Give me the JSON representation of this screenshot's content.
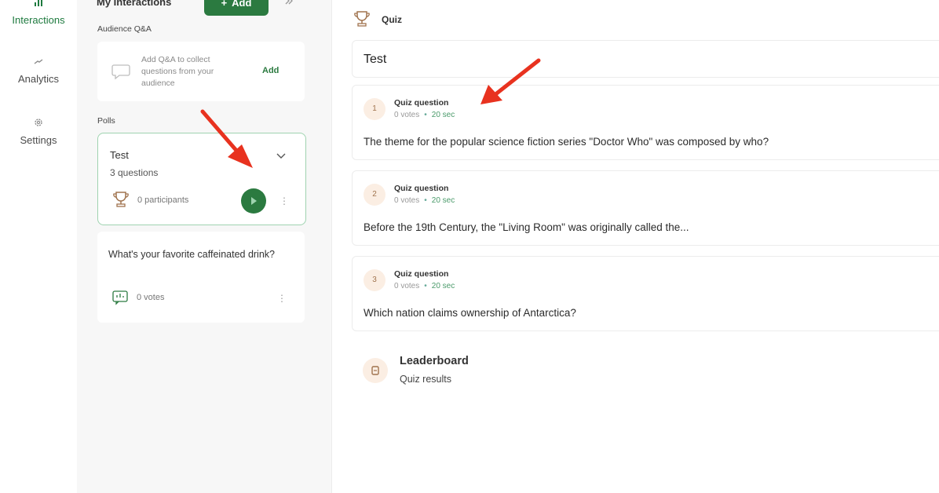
{
  "nav": {
    "items": [
      {
        "label": "Interactions",
        "icon": "bar-chart-icon",
        "active": true
      },
      {
        "label": "Analytics",
        "icon": "trend-icon",
        "active": false
      },
      {
        "label": "Settings",
        "icon": "gear-icon",
        "active": false
      }
    ]
  },
  "panel": {
    "title": "My Interactions",
    "add_button": "Add",
    "audience_qa_label": "Audience Q&A",
    "qa_card": {
      "text": "Add Q&A to collect questions from your audience",
      "action": "Add"
    },
    "polls_label": "Polls",
    "quiz_card": {
      "title": "Test",
      "subtitle": "3 questions",
      "participants": "0 participants"
    },
    "poll_card": {
      "title": "What's your favorite caffeinated drink?",
      "votes": "0 votes"
    }
  },
  "main": {
    "header": "Quiz",
    "quiz_title": "Test",
    "questions": [
      {
        "num": "1",
        "type": "Quiz question",
        "votes": "0 votes",
        "time": "20 sec",
        "text": "The theme for the popular science fiction series \"Doctor Who\" was composed by who?"
      },
      {
        "num": "2",
        "type": "Quiz question",
        "votes": "0 votes",
        "time": "20 sec",
        "text": "Before the 19th Century, the \"Living Room\" was originally called the..."
      },
      {
        "num": "3",
        "type": "Quiz question",
        "votes": "0 votes",
        "time": "20 sec",
        "text": "Which nation claims ownership of Antarctica?"
      }
    ],
    "leaderboard": {
      "title": "Leaderboard",
      "subtitle": "Quiz results"
    }
  },
  "colors": {
    "accent": "#2b7a40",
    "arrow": "#e8321f",
    "badge_bg": "#fbeee3"
  }
}
